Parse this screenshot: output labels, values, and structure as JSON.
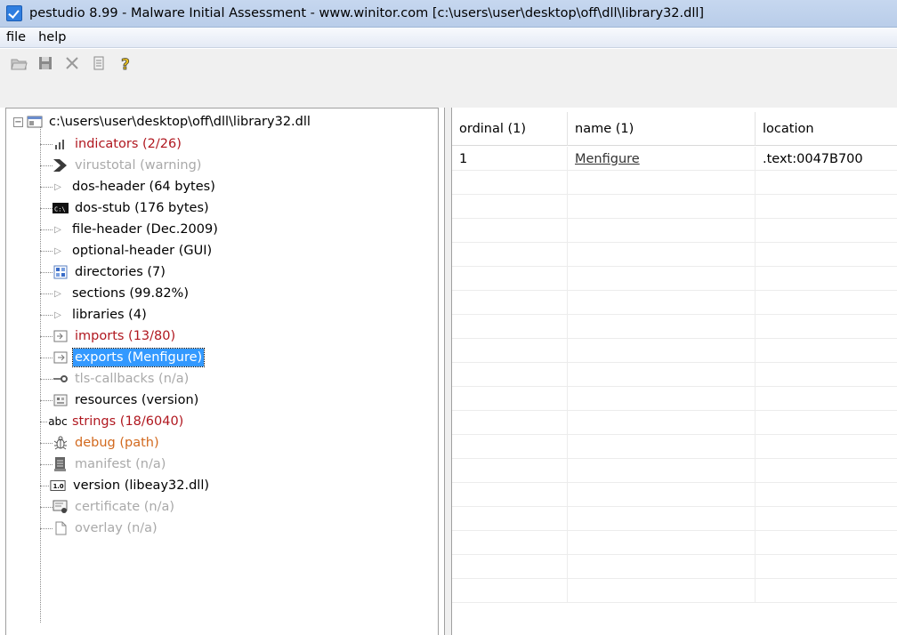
{
  "window": {
    "title": "pestudio 8.99 - Malware Initial Assessment - www.winitor.com [c:\\users\\user\\desktop\\off\\dll\\library32.dll]"
  },
  "menu": {
    "items": [
      "file",
      "help"
    ]
  },
  "toolbar": {
    "buttons": [
      "open-folder-icon",
      "save-icon",
      "close-icon",
      "document-icon",
      "help-icon"
    ]
  },
  "tree": {
    "root": "c:\\users\\user\\desktop\\off\\dll\\library32.dll",
    "items": [
      {
        "label": "indicators (2/26)",
        "icon": "indicators-icon",
        "color": "#b0171f"
      },
      {
        "label": "virustotal (warning)",
        "icon": "virustotal-icon",
        "color": "#a9a9a9"
      },
      {
        "label": "dos-header (64 bytes)",
        "icon": "expand-arrow-icon",
        "color": "#000000"
      },
      {
        "label": "dos-stub (176 bytes)",
        "icon": "console-icon",
        "color": "#000000"
      },
      {
        "label": "file-header (Dec.2009)",
        "icon": "expand-arrow-icon",
        "color": "#000000"
      },
      {
        "label": "optional-header (GUI)",
        "icon": "expand-arrow-icon",
        "color": "#000000"
      },
      {
        "label": "directories (7)",
        "icon": "directories-icon",
        "color": "#000000"
      },
      {
        "label": "sections (99.82%)",
        "icon": "expand-arrow-icon",
        "color": "#000000"
      },
      {
        "label": "libraries (4)",
        "icon": "expand-arrow-icon",
        "color": "#000000"
      },
      {
        "label": "imports (13/80)",
        "icon": "imports-icon",
        "color": "#b0171f"
      },
      {
        "label": "exports (Menfigure)",
        "icon": "exports-icon",
        "color": "#000000"
      },
      {
        "label": "tls-callbacks (n/a)",
        "icon": "tls-callbacks-icon",
        "color": "#a9a9a9"
      },
      {
        "label": "resources (version)",
        "icon": "resources-icon",
        "color": "#000000"
      },
      {
        "label": "strings (18/6040)",
        "icon": "strings-icon",
        "color": "#b0171f"
      },
      {
        "label": "debug (path)",
        "icon": "debug-bug-icon",
        "color": "#d2691e"
      },
      {
        "label": "manifest (n/a)",
        "icon": "manifest-icon",
        "color": "#a9a9a9"
      },
      {
        "label": "version (libeay32.dll)",
        "icon": "version-icon",
        "color": "#000000"
      },
      {
        "label": "certificate (n/a)",
        "icon": "certificate-icon",
        "color": "#a9a9a9"
      },
      {
        "label": "overlay (n/a)",
        "icon": "overlay-icon",
        "color": "#a9a9a9"
      }
    ],
    "icon_texts": {
      "strings": "abc",
      "version": "1.0",
      "dos_stub": "C:\\"
    }
  },
  "table": {
    "columns": [
      "ordinal (1)",
      "name (1)",
      "location"
    ],
    "rows": [
      {
        "ordinal": "1",
        "name": "Menfigure",
        "location": ".text:0047B700"
      }
    ]
  }
}
